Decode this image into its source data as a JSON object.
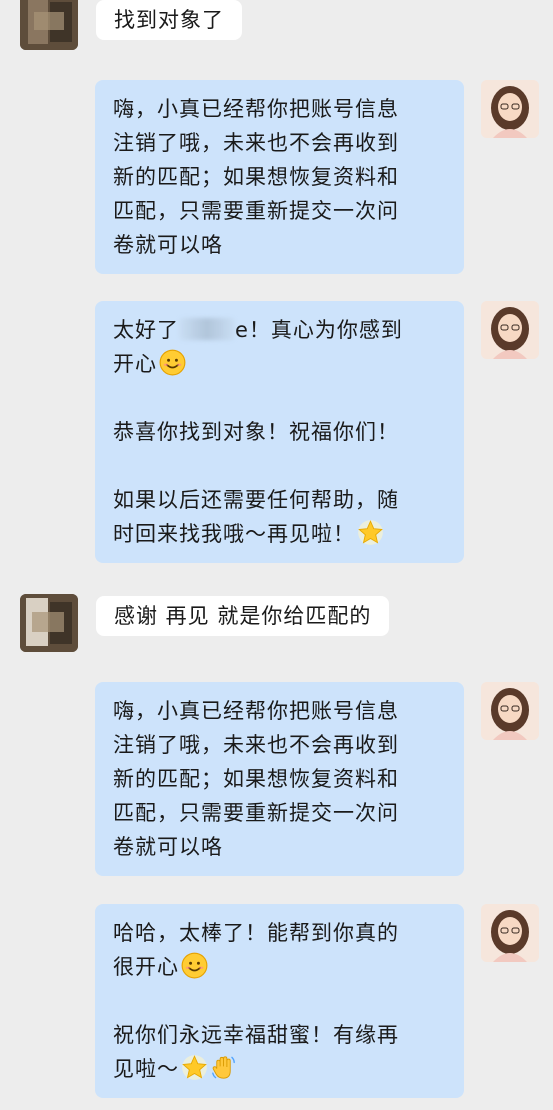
{
  "messages": [
    {
      "id": "m1",
      "sender": "user",
      "lines": [
        "找到对象了"
      ]
    },
    {
      "id": "m2",
      "sender": "bot",
      "lines": [
        "嗨，小真已经帮你把账号信息",
        "注销了哦，未来也不会再收到",
        "新的匹配；如果想恢复资料和",
        "匹配，只需要重新提交一次问",
        "卷就可以咯"
      ]
    },
    {
      "id": "m3",
      "sender": "bot",
      "parts": {
        "a_prefix": "太好了",
        "a_suffix": "e！真心为你感到",
        "b_text": "开心",
        "c_text": "恭喜你找到对象！祝福你们！",
        "d_line1": "如果以后还需要任何帮助，随",
        "d_line2": "时回来找我哦～再见啦！"
      }
    },
    {
      "id": "m4",
      "sender": "user",
      "lines": [
        "感谢 再见 就是你给匹配的"
      ]
    },
    {
      "id": "m5",
      "sender": "bot",
      "lines": [
        "嗨，小真已经帮你把账号信息",
        "注销了哦，未来也不会再收到",
        "新的匹配；如果想恢复资料和",
        "匹配，只需要重新提交一次问",
        "卷就可以咯"
      ]
    },
    {
      "id": "m6",
      "sender": "bot",
      "parts": {
        "a_line1": "哈哈，太棒了！能帮到你真的",
        "a_line2": "很开心",
        "b_line1": "祝你们永远幸福甜蜜！有缘再",
        "b_line2": "见啦～"
      }
    }
  ],
  "emojis": {
    "smile": "smiling-face-emoji",
    "star": "glowing-star-emoji",
    "wave": "waving-hand-emoji"
  },
  "colors": {
    "background": "#ededed",
    "user_bubble": "#ffffff",
    "bot_bubble": "#cde3fb"
  }
}
